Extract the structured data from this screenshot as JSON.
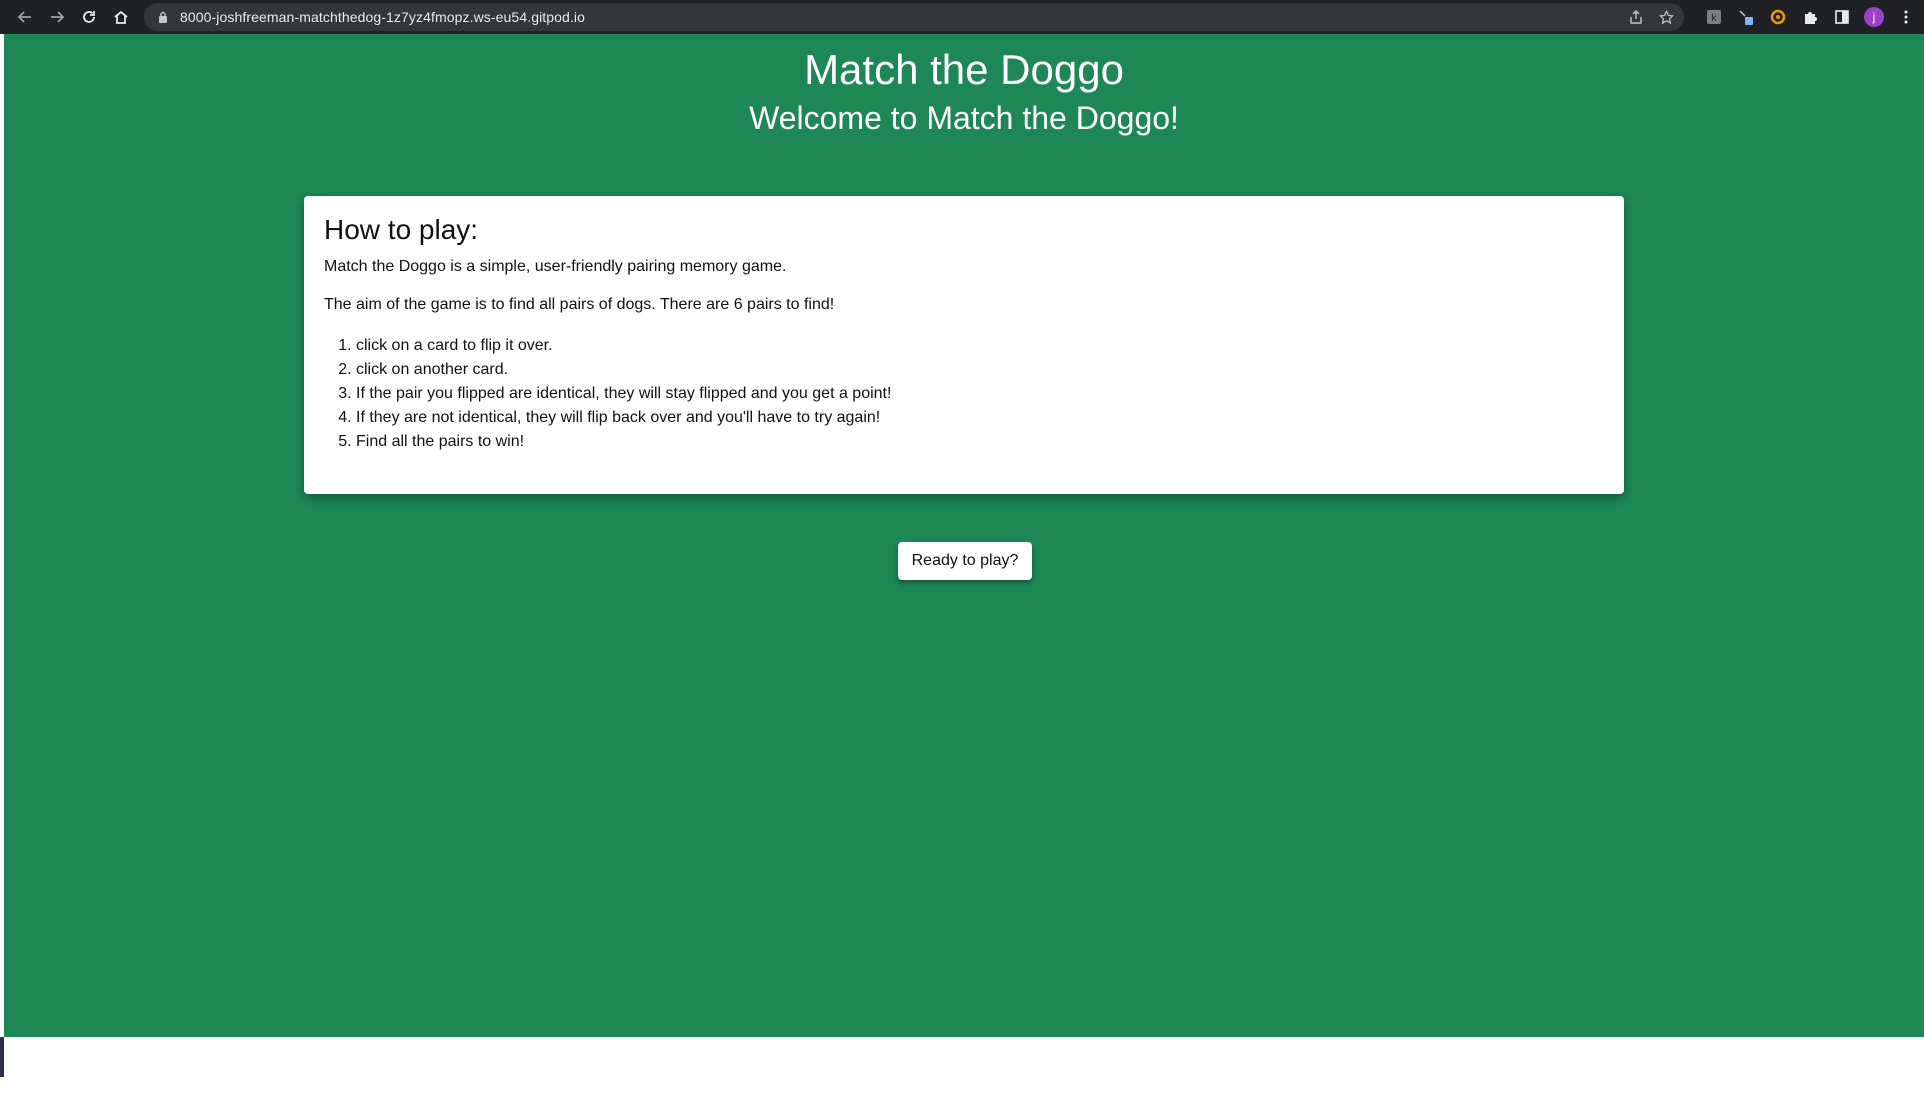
{
  "browser": {
    "url": "8000-joshfreeman-matchthedog-1z7yz4fmopz.ws-eu54.gitpod.io",
    "profile_initial": "j",
    "icons": {
      "back": "back-arrow-icon",
      "forward": "forward-arrow-icon",
      "reload": "reload-icon",
      "home": "home-icon",
      "lock": "lock-icon",
      "share": "share-icon",
      "bookmark": "star-icon",
      "extensions": "puzzle-icon",
      "sidepanel": "side-panel-icon",
      "menu": "kebab-menu-icon"
    }
  },
  "page": {
    "background_color": "#1d8855",
    "title": "Match the Doggo",
    "subtitle": "Welcome to Match the Doggo!",
    "instructions": {
      "heading": "How to play:",
      "intro": "Match the Doggo is a simple, user-friendly pairing memory game.",
      "aim": "The aim of the game is to find all pairs of dogs. There are 6 pairs to find!",
      "steps": [
        "click on a card to flip it over.",
        "click on another card.",
        "If the pair you flipped are identical, they will stay flipped and you get a point!",
        "If they are not identical, they will flip back over and you'll have to try again!",
        "Find all the pairs to win!"
      ]
    },
    "play_button_label": "Ready to play?"
  }
}
